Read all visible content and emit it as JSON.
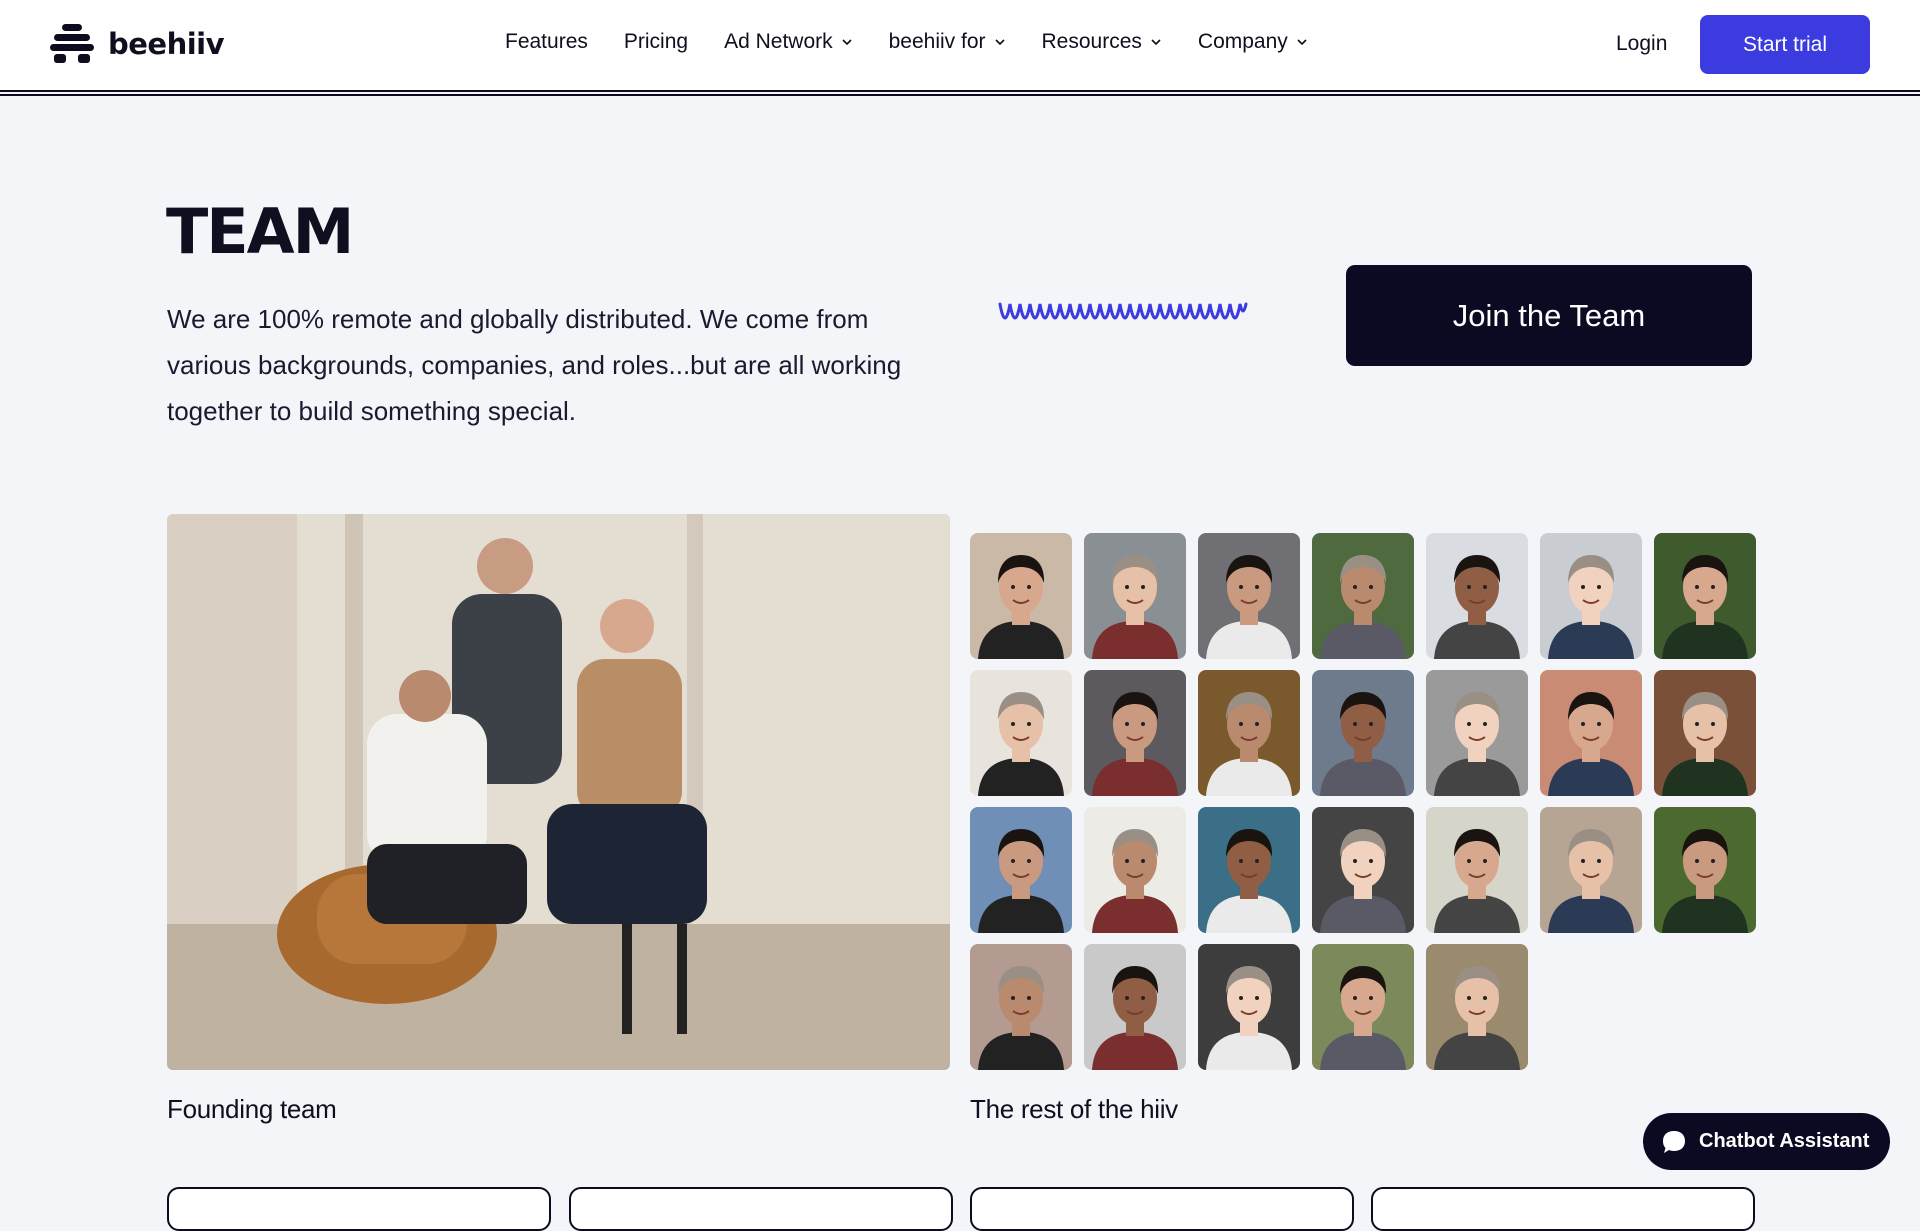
{
  "brand": {
    "name": "beehiiv",
    "icon": "beehive-logo-icon"
  },
  "nav": {
    "items": [
      {
        "label": "Features",
        "dropdown": false
      },
      {
        "label": "Pricing",
        "dropdown": false
      },
      {
        "label": "Ad Network",
        "dropdown": true
      },
      {
        "label": "beehiiv for",
        "dropdown": true
      },
      {
        "label": "Resources",
        "dropdown": true
      },
      {
        "label": "Company",
        "dropdown": true
      }
    ],
    "login": "Login",
    "cta": "Start trial"
  },
  "team": {
    "title": "TEAM",
    "intro": "We are 100% remote and globally distributed. We come from various backgrounds, companies, and roles...but are all working together to build something special.",
    "join_label": "Join the Team",
    "founding_caption": "Founding team",
    "rest_caption": "The rest of the hiiv",
    "member_photo_count": 26
  },
  "chatbot": {
    "label": "Chatbot Assistant",
    "icon": "chat-bubble-icon"
  },
  "colors": {
    "accent": "#3b3be0",
    "dark": "#0b0a22",
    "background": "#f4f5f9",
    "squiggle": "#3b3be0"
  }
}
